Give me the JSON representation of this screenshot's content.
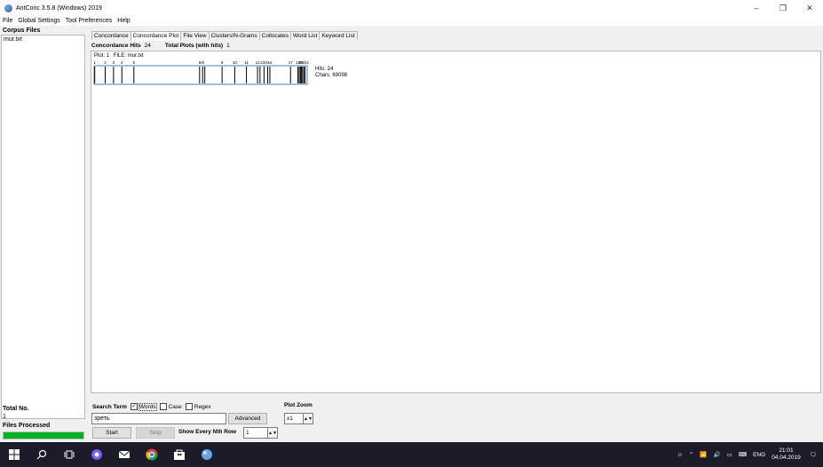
{
  "window": {
    "title": "AntConc 3.5.8 (Windows) 2019",
    "controls": [
      "–",
      "❐",
      "✕"
    ]
  },
  "menu": [
    "File",
    "Global Settings",
    "Tool Preferences",
    "Help"
  ],
  "left_panel": {
    "corpus_files_label": "Corpus Files",
    "files": [
      "mur.txt"
    ],
    "total_no_label": "Total No.",
    "total_no_value": "1",
    "files_processed_label": "Files Processed",
    "progress_percent": 100
  },
  "tabs": [
    {
      "label": "Concordance",
      "active": false
    },
    {
      "label": "Concordance Plot",
      "active": true
    },
    {
      "label": "File View",
      "active": false
    },
    {
      "label": "Clusters/N-Grams",
      "active": false
    },
    {
      "label": "Collocates",
      "active": false
    },
    {
      "label": "Word List",
      "active": false
    },
    {
      "label": "Keyword List",
      "active": false
    }
  ],
  "info": {
    "hits_label": "Concordance Hits",
    "hits_value": "24",
    "plots_label": "Total Plots (with hits)",
    "plots_value": "1"
  },
  "plot": {
    "plot_label": "Plot: 1",
    "file_label": "FILE: mur.txt",
    "hits_text": "Hits: 24",
    "chars_text": "Chars: 69098",
    "total_chars": 69098,
    "hit_positions": [
      200,
      3600,
      6300,
      9000,
      12900,
      34200,
      35200,
      35900,
      41500,
      45600,
      49400,
      53000,
      53800,
      55100,
      56300,
      57000,
      63700,
      66100,
      66500,
      66900,
      67200,
      67600,
      68000,
      68400
    ],
    "tick_labels": [
      {
        "text": "1",
        "pos": 200
      },
      {
        "text": "2",
        "pos": 3600
      },
      {
        "text": "3",
        "pos": 6300
      },
      {
        "text": "4",
        "pos": 9000
      },
      {
        "text": "5",
        "pos": 12900
      },
      {
        "text": "6/8",
        "pos": 34800
      },
      {
        "text": "9",
        "pos": 41500
      },
      {
        "text": "10",
        "pos": 45600
      },
      {
        "text": "11",
        "pos": 49400
      },
      {
        "text": "12",
        "pos": 53000
      },
      {
        "text": "13/4",
        "pos": 55100
      },
      {
        "text": "16",
        "pos": 57000
      },
      {
        "text": "17",
        "pos": 63700
      },
      {
        "text": "18/9",
        "pos": 66600
      },
      {
        "text": "20/24",
        "pos": 68000
      }
    ]
  },
  "search": {
    "label": "Search Term",
    "words_label": "Words",
    "words_checked": true,
    "case_label": "Case",
    "case_checked": false,
    "regex_label": "Regex",
    "regex_checked": false,
    "term": "зреть",
    "advanced_label": "Advanced",
    "plot_zoom_label": "Plot Zoom",
    "zoom_value": "x1",
    "start_label": "Start",
    "stop_label": "Stop",
    "nth_row_label": "Show Every Nth Row",
    "nth_row_value": "1"
  },
  "taskbar": {
    "lang": "ENG",
    "time": "21:01",
    "date": "04.04.2019"
  },
  "colors": {
    "progress": "#06b025",
    "plot_border": "#4a7fc1",
    "taskbar": "#1b1b2a"
  }
}
